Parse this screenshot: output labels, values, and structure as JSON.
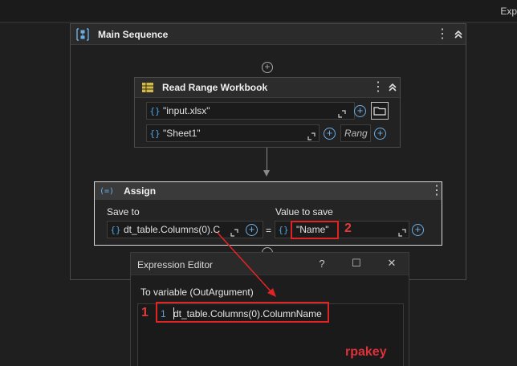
{
  "topbar": {
    "right_text": "Exp"
  },
  "main_sequence": {
    "title": "Main Sequence"
  },
  "read_range": {
    "title": "Read Range Workbook",
    "workbook_path": "\"input.xlsx\"",
    "sheet_name": "\"Sheet1\"",
    "range_placeholder": "Rang"
  },
  "assign": {
    "title": "Assign",
    "icon_text": "(=)",
    "save_to_label": "Save to",
    "value_to_save_label": "Value to save",
    "save_to_value": "dt_table.Columns(0).C",
    "value_to_save_value": "\"Name\"",
    "equals": "="
  },
  "braces": "{}",
  "annotations": {
    "marker_1": "1",
    "marker_2": "2",
    "annotation_color": "#e02424"
  },
  "expression_editor": {
    "title": "Expression Editor",
    "help": "?",
    "maximize": "☐",
    "close": "✕",
    "variable_label": "To variable (OutArgument)",
    "line_number": "1",
    "code_line": "dt_table.Columns(0).ColumnName"
  },
  "watermark": "rpakey",
  "colors": {
    "accent_blue": "#4ea3e0",
    "background": "#1f1f1f"
  },
  "icons": {
    "sequence": "sequence-icon",
    "workbook": "spreadsheet-icon",
    "expand": "expand-icon",
    "add": "plus-circle-icon",
    "folder": "folder-icon",
    "kebab": "kebab-menu-icon",
    "collapse": "collapse-chevrons-icon"
  }
}
